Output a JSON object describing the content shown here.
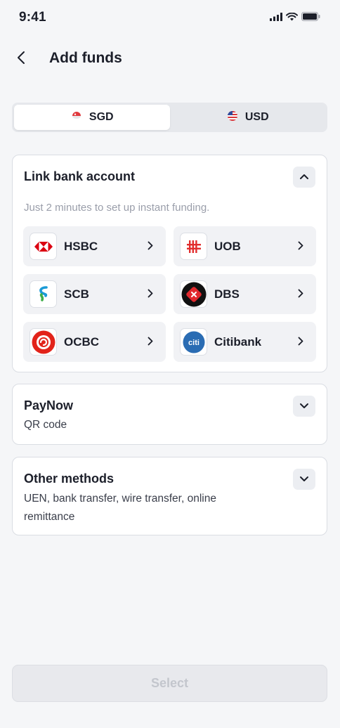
{
  "status_bar": {
    "time": "9:41"
  },
  "header": {
    "title": "Add funds"
  },
  "currency_tabs": [
    {
      "label": "SGD",
      "active": true
    },
    {
      "label": "USD",
      "active": false
    }
  ],
  "link_bank": {
    "title": "Link bank account",
    "subtitle": "Just 2 minutes to set up instant funding.",
    "banks": [
      {
        "name": "HSBC",
        "logo": "hsbc-logo-icon"
      },
      {
        "name": "UOB",
        "logo": "uob-logo-icon"
      },
      {
        "name": "SCB",
        "logo": "scb-logo-icon"
      },
      {
        "name": "DBS",
        "logo": "dbs-logo-icon"
      },
      {
        "name": "OCBC",
        "logo": "ocbc-logo-icon"
      },
      {
        "name": "Citibank",
        "logo": "citibank-logo-icon",
        "logo_text": "citi"
      }
    ]
  },
  "paynow": {
    "title": "PayNow",
    "subtitle": "QR code"
  },
  "other_methods": {
    "title": "Other methods",
    "subtitle": "UEN, bank transfer, wire transfer, online remittance"
  },
  "footer": {
    "select_label": "Select"
  },
  "colors": {
    "background": "#f5f6f8",
    "card_border": "#dadde3",
    "text_primary": "#1c1f2a",
    "text_muted": "#9a9eaa",
    "disabled_text": "#c3c6cd"
  }
}
